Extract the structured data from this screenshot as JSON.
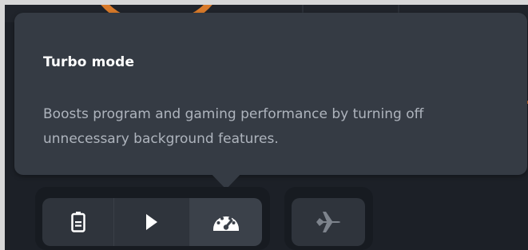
{
  "tooltip": {
    "title": "Turbo mode",
    "description": "Boosts program and gaming performance by turning off unnecessary background features."
  },
  "modes": [
    {
      "icon": "battery-icon",
      "selected": false
    },
    {
      "icon": "play-icon",
      "selected": false
    },
    {
      "icon": "speedometer-icon",
      "selected": true
    }
  ],
  "airplane_mode": {
    "icon": "airplane-icon",
    "enabled": false
  },
  "colors": {
    "tooltip_bg": "#353b44",
    "title_text": "#ffffff",
    "description_text": "#aeb4bd",
    "button_bg": "#2f343c",
    "selected_button_bg": "#3b414a",
    "icon_active": "#ffffff",
    "icon_disabled": "#7d838c",
    "accent_orange": "#d97a2a"
  }
}
